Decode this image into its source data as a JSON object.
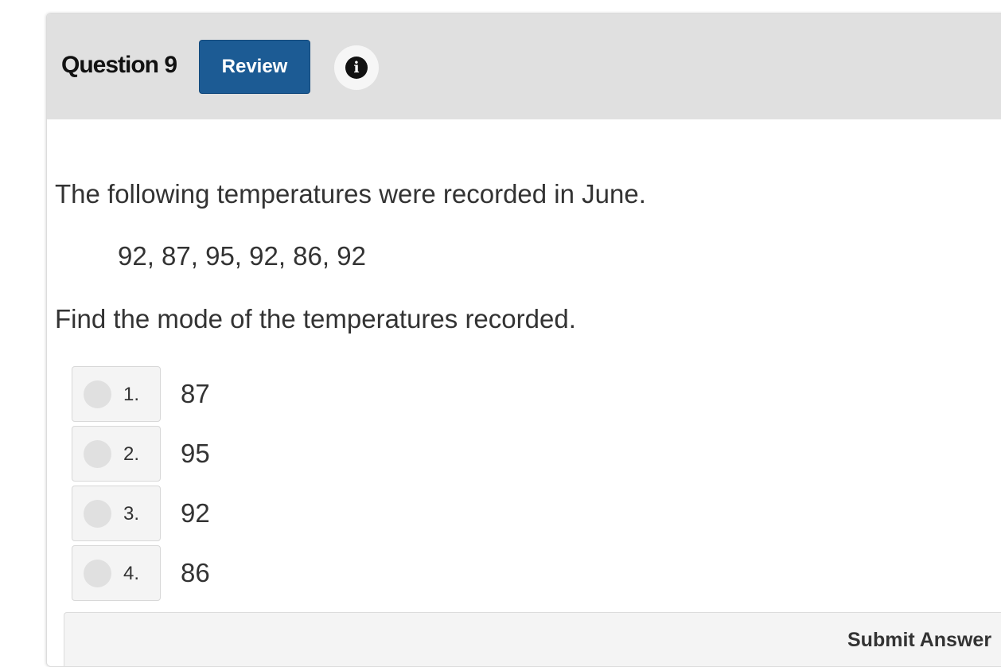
{
  "header": {
    "title": "Question 9",
    "review_label": "Review",
    "info_icon": "info-circle-icon"
  },
  "question": {
    "intro": "The following temperatures were recorded in June.",
    "data": "92, 87, 95, 92, 86, 92",
    "prompt": "Find the mode of the temperatures recorded."
  },
  "choices": [
    {
      "number": "1.",
      "text": "87"
    },
    {
      "number": "2.",
      "text": "95"
    },
    {
      "number": "3.",
      "text": "92"
    },
    {
      "number": "4.",
      "text": "86"
    }
  ],
  "footer": {
    "submit_label": "Submit Answer"
  },
  "colors": {
    "header_bg": "#e0e0e0",
    "review_button": "#1c5b94",
    "choice_bg": "#f4f4f4",
    "radio": "#e0e0e0"
  }
}
